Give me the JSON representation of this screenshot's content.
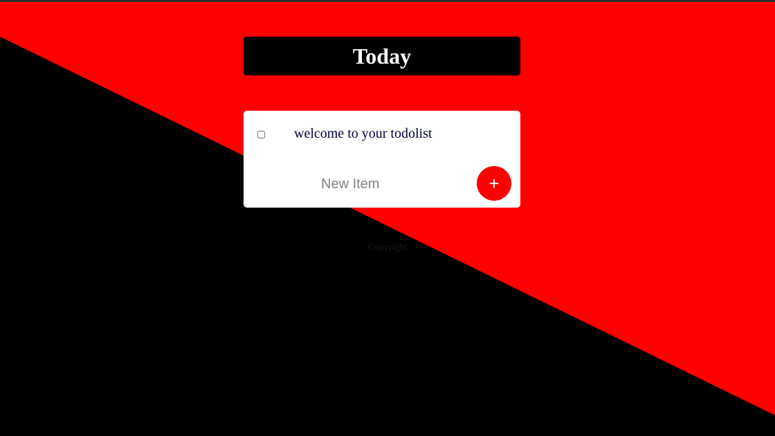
{
  "colors": {
    "background_dark": "#000000",
    "background_accent": "#ff0000",
    "card": "#ffffff",
    "item_text": "#00003a",
    "add_button": "#ff0000"
  },
  "header": {
    "title": "Today"
  },
  "list": {
    "items": [
      {
        "label": "welcome to your todolist",
        "checked": false
      }
    ]
  },
  "new_item": {
    "placeholder": "New Item",
    "value": "",
    "add_icon": "plus-icon",
    "add_label": "+"
  },
  "footer": {
    "text": "Copyright"
  }
}
